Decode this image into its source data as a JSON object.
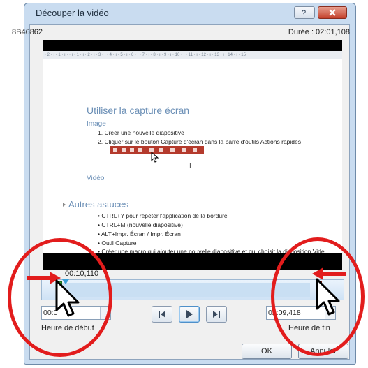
{
  "window": {
    "title": "Découper la vidéo",
    "help_icon": "help-icon",
    "close_icon": "close-icon"
  },
  "info": {
    "id_text": "8B46862",
    "duration_text": "Durée : 02:01,108"
  },
  "video_frame": {
    "ruler_text": "· 2 · ı · 1 · ı ·   · ı · 1 · ı · 2 · ı · 3 · ı · 4 · ı · 5 · ı · 6 · ı · 7 · ı · 8 · ı · 9 · ı · 10 · ı · 11 · ı · 12 · ı · 13 · ı · 14 · ı · 15",
    "heading_capture": "Utiliser la capture écran",
    "sub_image": "Image",
    "list1": [
      "1.   Créer une nouvelle diapositive",
      "2.   Cliquer sur le bouton Capture d'écran dans la barre d'outils Actions rapides"
    ],
    "sub_video": "Vidéo",
    "ibeam": "I",
    "heading_tips": "Autres astuces",
    "list2": [
      "•   CTRL+Y pour répéter l'application de la bordure",
      "•   CTRL+M (nouvelle diapositive)",
      "•   ALT+Impr. Écran / Impr. Écran",
      "•   Outil Capture",
      "•   Créer une macro qui ajouter une nouvelle diapositive et qui choisit la disposition Vide"
    ]
  },
  "timeline": {
    "current_time": "00:10,110",
    "start_position": 0.056,
    "end_position": 0.917
  },
  "start": {
    "value": "00:0",
    "label": "Heure de début"
  },
  "end": {
    "value": "02:09,418",
    "label": "Heure de fin"
  },
  "playback": {
    "prev_icon": "previous-frame-icon",
    "play_icon": "play-icon",
    "next_icon": "next-frame-icon"
  },
  "buttons": {
    "ok": "OK",
    "cancel": "Annuler"
  },
  "colors": {
    "annotation_red": "#e21c1c",
    "start_marker": "#3ea83e",
    "end_marker": "#c0392b",
    "heading_blue": "#6b8fb6"
  }
}
